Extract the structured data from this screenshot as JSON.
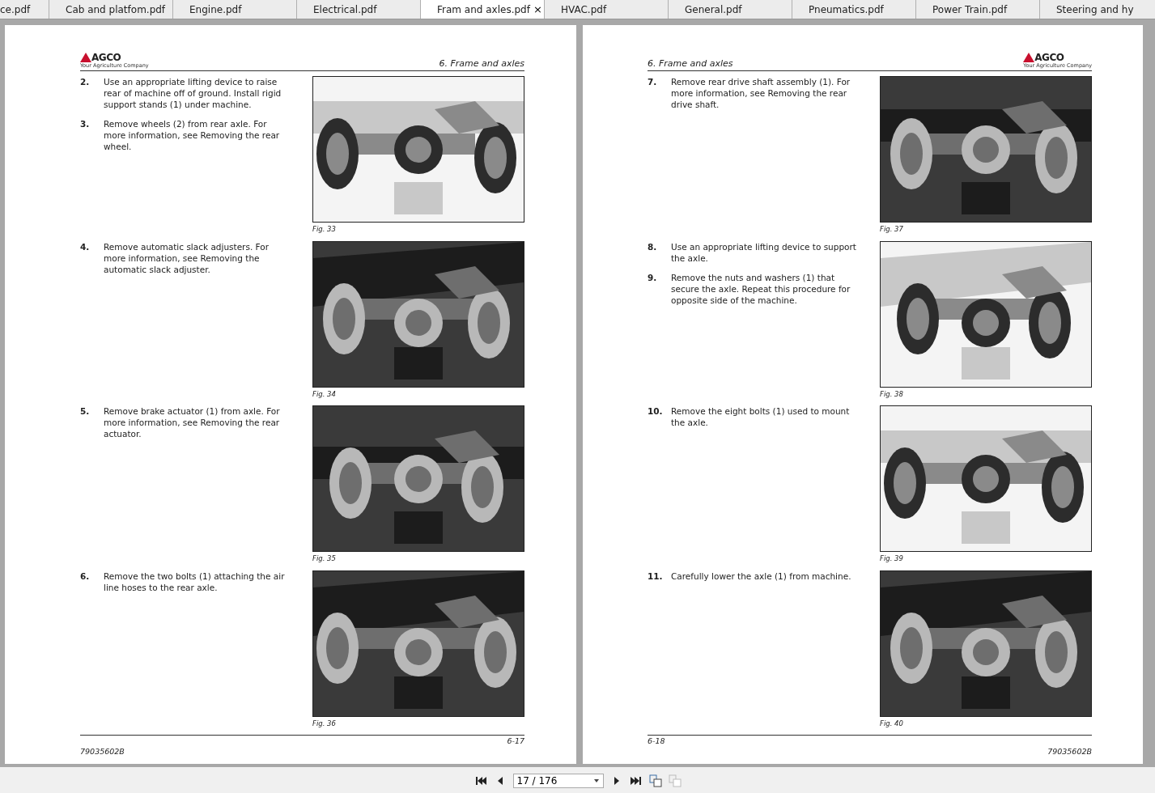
{
  "tabs": [
    {
      "label": "ce.pdf",
      "selected": false
    },
    {
      "label": "Cab and platfom.pdf",
      "selected": false
    },
    {
      "label": "Engine.pdf",
      "selected": false
    },
    {
      "label": "Electrical.pdf",
      "selected": false
    },
    {
      "label": "Fram and axles.pdf",
      "selected": true,
      "close": "×"
    },
    {
      "label": "HVAC.pdf",
      "selected": false
    },
    {
      "label": "General.pdf",
      "selected": false
    },
    {
      "label": "Pneumatics.pdf",
      "selected": false
    },
    {
      "label": "Power Train.pdf",
      "selected": false
    },
    {
      "label": "Steering and hy",
      "selected": false
    }
  ],
  "pages": [
    {
      "logo": {
        "name": "AGCO",
        "tagline": "Your Agriculture Company"
      },
      "header": "6. Frame and axles",
      "page_number": "6-17",
      "doc_number": "79035602B",
      "blocks": [
        {
          "steps": [
            {
              "number": "2.",
              "text": "Use an appropriate lifting device to raise rear of machine off of ground. Install rigid support stands (1) under machine."
            },
            {
              "number": "3.",
              "text": "Remove wheels (2) from rear axle. For more information, see Removing the rear wheel."
            }
          ],
          "figure": {
            "kind": "picture",
            "caption": "Fig. 33"
          }
        },
        {
          "steps": [
            {
              "number": "4.",
              "text": "Remove automatic slack adjusters. For more information, see Removing the automatic slack adjuster."
            }
          ],
          "figure": {
            "kind": "picture",
            "caption": "Fig. 34"
          }
        },
        {
          "steps": [
            {
              "number": "5.",
              "text": "Remove brake actuator (1) from axle. For more information, see Removing the rear actuator."
            }
          ],
          "figure": {
            "kind": "picture",
            "caption": "Fig. 35"
          }
        },
        {
          "steps": [
            {
              "number": "6.",
              "text": "Remove the two bolts (1) attaching the air line hoses to the rear axle."
            }
          ],
          "figure": {
            "kind": "picture",
            "caption": "Fig. 36"
          }
        }
      ]
    },
    {
      "logo": {
        "name": "AGCO",
        "tagline": "Your Agriculture Company"
      },
      "header": "6. Frame and axles",
      "page_number": "6-18",
      "doc_number": "79035602B",
      "blocks": [
        {
          "steps": [
            {
              "number": "7.",
              "text": "Remove rear drive shaft assembly (1). For more information, see Removing the rear drive shaft."
            }
          ],
          "figure": {
            "kind": "picture",
            "caption": "Fig. 37"
          }
        },
        {
          "steps": [
            {
              "number": "8.",
              "text": "Use an appropriate lifting device to support the axle."
            },
            {
              "number": "9.",
              "text": "Remove the nuts and washers (1) that secure the axle. Repeat this procedure for opposite side of the machine."
            }
          ],
          "figure": {
            "kind": "picture",
            "caption": "Fig. 38"
          }
        },
        {
          "steps": [
            {
              "number": "10.",
              "text": "Remove the eight bolts (1) used to mount the axle."
            }
          ],
          "figure": {
            "kind": "picture",
            "caption": "Fig. 39"
          }
        },
        {
          "steps": [
            {
              "number": "11.",
              "text": "Carefully lower the axle (1) from machine."
            }
          ],
          "figure": {
            "kind": "picture",
            "caption": "Fig. 40"
          }
        }
      ]
    }
  ],
  "toolbar": {
    "page_field": "17 / 176"
  }
}
